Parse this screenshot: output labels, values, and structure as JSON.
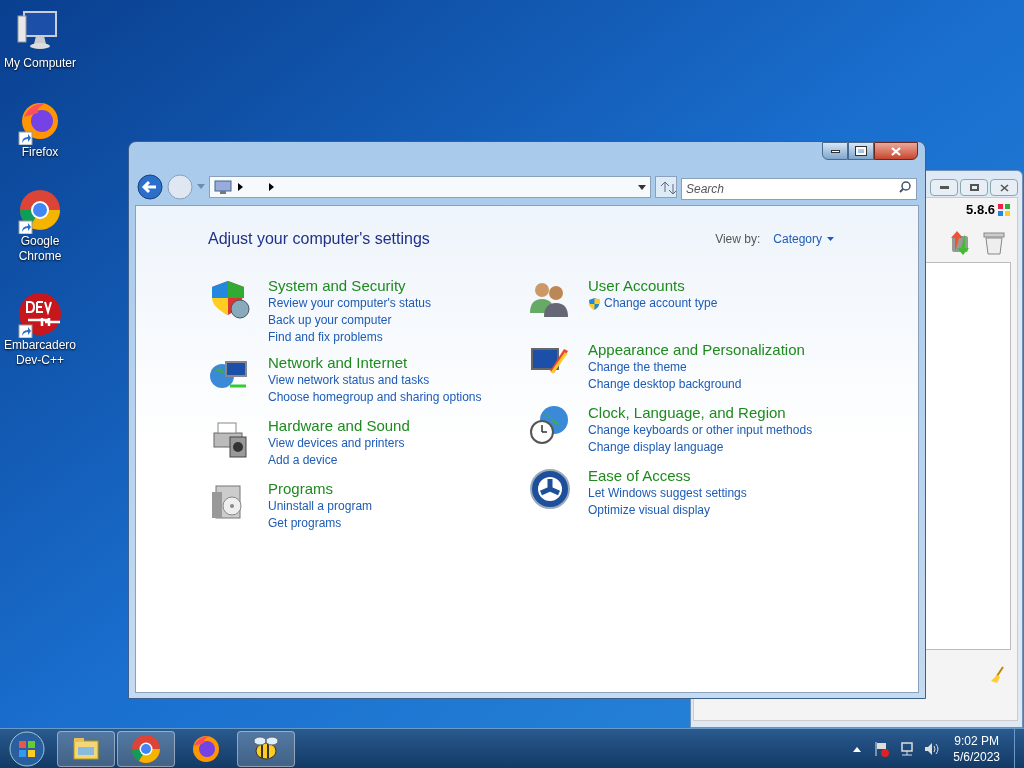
{
  "desktop_icons": [
    {
      "label": "My Computer",
      "kind": "computer",
      "shortcut": false
    },
    {
      "label": "Firefox",
      "kind": "firefox",
      "shortcut": true
    },
    {
      "label": "Google Chrome",
      "kind": "chrome",
      "shortcut": true
    },
    {
      "label": "Embarcadero Dev-C++",
      "kind": "devcpp",
      "shortcut": true
    }
  ],
  "background_window": {
    "version": "5.8.6"
  },
  "control_panel": {
    "search": {
      "placeholder": "Search"
    },
    "heading": "Adjust your computer's settings",
    "view_by": {
      "label": "View by:",
      "value": "Category"
    },
    "columns": [
      [
        {
          "title": "System and Security",
          "kind": "shield",
          "links": [
            {
              "text": "Review your computer's status",
              "shield": false
            },
            {
              "text": "Back up your computer",
              "shield": false
            },
            {
              "text": "Find and fix problems",
              "shield": false
            }
          ]
        },
        {
          "title": "Network and Internet",
          "kind": "network",
          "links": [
            {
              "text": "View network status and tasks",
              "shield": false
            },
            {
              "text": "Choose homegroup and sharing options",
              "shield": false
            }
          ]
        },
        {
          "title": "Hardware and Sound",
          "kind": "printer",
          "links": [
            {
              "text": "View devices and printers",
              "shield": false
            },
            {
              "text": "Add a device",
              "shield": false
            }
          ]
        },
        {
          "title": "Programs",
          "kind": "programs",
          "links": [
            {
              "text": "Uninstall a program",
              "shield": false
            },
            {
              "text": "Get programs",
              "shield": false
            }
          ]
        }
      ],
      [
        {
          "title": "User Accounts",
          "kind": "users",
          "links": [
            {
              "text": "Change account type",
              "shield": true
            }
          ]
        },
        {
          "title": "Appearance and Personalization",
          "kind": "appearance",
          "links": [
            {
              "text": "Change the theme",
              "shield": false
            },
            {
              "text": "Change desktop background",
              "shield": false
            }
          ]
        },
        {
          "title": "Clock, Language, and Region",
          "kind": "clock",
          "links": [
            {
              "text": "Change keyboards or other input methods",
              "shield": false
            },
            {
              "text": "Change display language",
              "shield": false
            }
          ]
        },
        {
          "title": "Ease of Access",
          "kind": "access",
          "links": [
            {
              "text": "Let Windows suggest settings",
              "shield": false
            },
            {
              "text": "Optimize visual display",
              "shield": false
            }
          ]
        }
      ]
    ]
  },
  "taskbar": {
    "buttons": [
      {
        "kind": "explorer",
        "running": true
      },
      {
        "kind": "chrome",
        "running": true
      },
      {
        "kind": "firefox",
        "running": false
      },
      {
        "kind": "bee",
        "running": true
      }
    ],
    "time": "9:02 PM",
    "date": "5/6/2023"
  }
}
